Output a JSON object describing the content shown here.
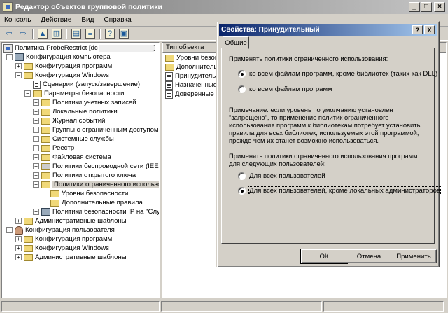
{
  "window": {
    "title": "Редактор объектов групповой политики"
  },
  "menu": [
    "Консоль",
    "Действие",
    "Вид",
    "Справка"
  ],
  "tree": {
    "root": "Политика ProbeRestrict [dc",
    "items": [
      "Конфигурация компьютера",
      "Конфигурация программ",
      "Конфигурация Windows",
      "Сценарии (запуск/завершение)",
      "Параметры безопасности",
      "Политики учетных записей",
      "Локальные политики",
      "Журнал событий",
      "Группы с ограниченным доступом",
      "Системные службы",
      "Реестр",
      "Файловая система",
      "Политики беспроводной сети (IEEE",
      "Политики открытого ключа",
      "Политики ограниченного использов",
      "Уровни безопасности",
      "Дополнительные правила",
      "Политики безопасности IP на \"Слу",
      "Административные шаблоны",
      "Конфигурация пользователя",
      "Конфигурация программ",
      "Конфигурация Windows",
      "Административные шаблоны"
    ]
  },
  "list": {
    "header": "Тип объекта",
    "items": [
      "Уровни безопа",
      "Дополнительн",
      "Принудительн",
      "Назначенные т",
      "Доверенные из"
    ]
  },
  "dialog": {
    "title": "Свойства: Принудительный",
    "help_label": "?",
    "close_label": "X",
    "tab": "Общие",
    "section1": "Применять политики ограниченного использования:",
    "radio1a": "ко всем файлам программ, кроме библиотек (таких как DLL)",
    "radio1b": "ко всем файлам программ",
    "note": "Примечание: если уровень по умолчанию установлен \"запрещено\", то применение политик ограниченного использования программ к библиотекам потребует установить правила для всех библиотек, используемых этой программой, прежде чем их станет возможно использоваться.",
    "section2": "Применять политики ограниченного использования программ для следующих пользователей:",
    "radio2a": "Для всех пользователей",
    "radio2b": "Для всех пользователей, кроме локальных администраторов",
    "ok": "ОК",
    "cancel": "Отмена",
    "apply": "Применить"
  }
}
